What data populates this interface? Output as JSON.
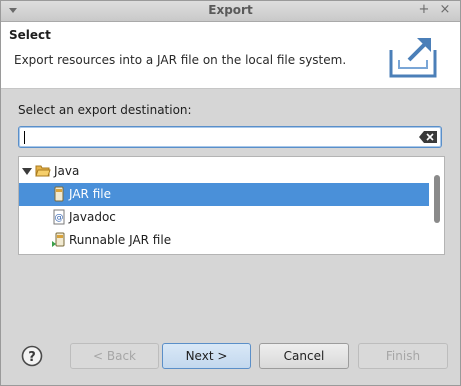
{
  "window": {
    "title": "Export"
  },
  "header": {
    "title": "Select",
    "description": "Export resources into a JAR file on the local file system."
  },
  "destination": {
    "label": "Select an export destination:",
    "filter_value": ""
  },
  "tree": {
    "items": [
      {
        "label": "Java",
        "level": 0,
        "expanded": true,
        "icon": "folder-open-icon"
      },
      {
        "label": "JAR file",
        "level": 1,
        "selected": true,
        "icon": "jar-file-icon"
      },
      {
        "label": "Javadoc",
        "level": 1,
        "icon": "javadoc-icon"
      },
      {
        "label": "Runnable JAR file",
        "level": 1,
        "icon": "runnable-jar-icon"
      }
    ]
  },
  "buttons": {
    "back": "< Back",
    "next": "Next >",
    "cancel": "Cancel",
    "finish": "Finish"
  },
  "colors": {
    "selection": "#4a90d9",
    "dialog_bg": "#d6d6d6"
  }
}
